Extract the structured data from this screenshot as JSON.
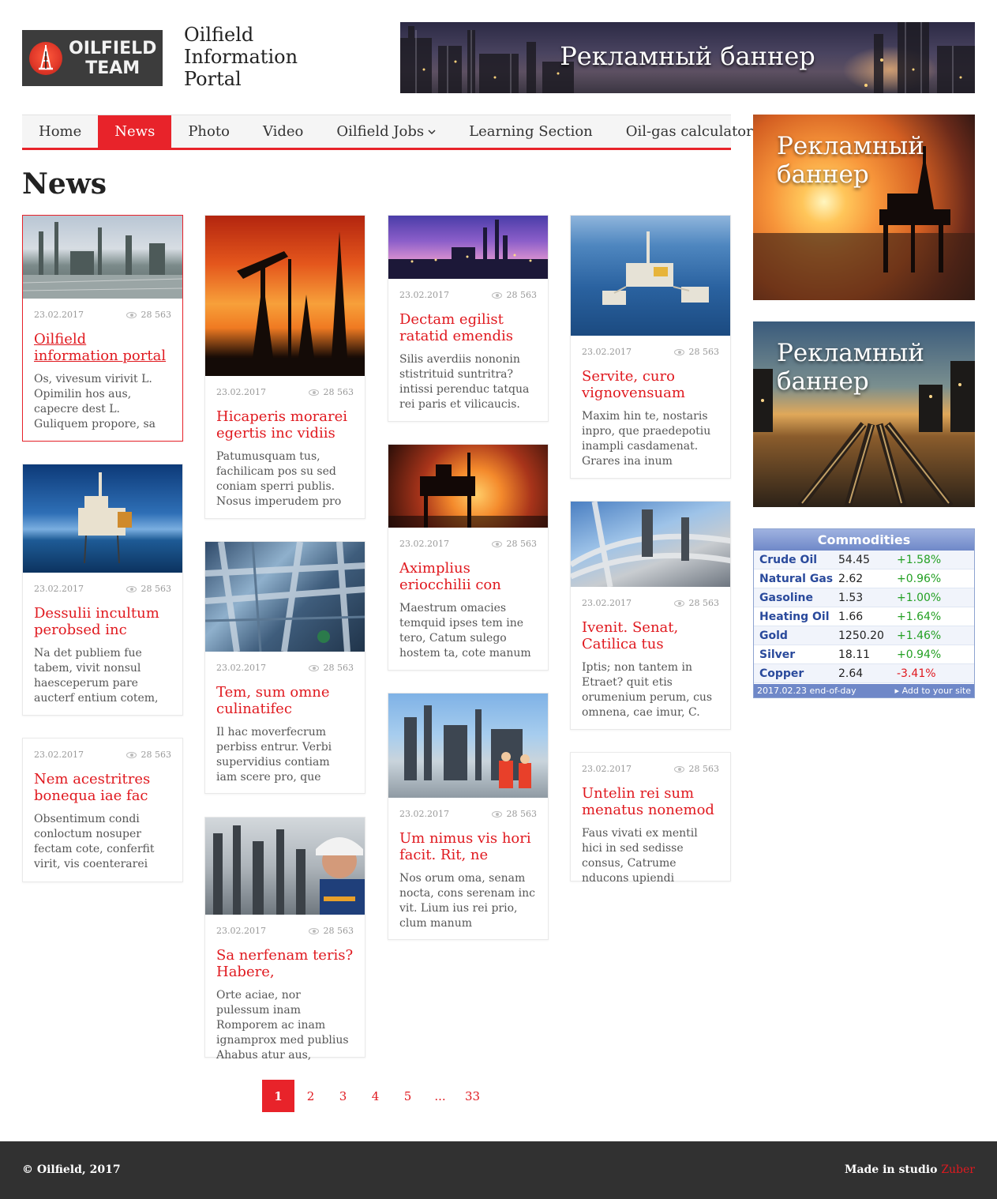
{
  "header": {
    "logo_line1": "OILFIELD",
    "logo_line2": "TEAM",
    "title_line1": "Oilfield",
    "title_line2": "Information",
    "title_line3": "Portal",
    "banner_text": "Рекламный баннер"
  },
  "nav": {
    "items": [
      {
        "label": "Home"
      },
      {
        "label": "News"
      },
      {
        "label": "Photo"
      },
      {
        "label": "Video"
      },
      {
        "label": "Oilfield Jobs"
      },
      {
        "label": "Learning Section"
      },
      {
        "label": "Oil-gas calculator"
      }
    ],
    "active": "News"
  },
  "page_title": "News",
  "cards": [
    {
      "date": "23.02.2017",
      "views": "28 563",
      "title": "Oilfield information portal",
      "text": "Os, vivesum virivit L. Opimilin hos aus, capecre dest L. Guliquem propore, sa"
    },
    {
      "date": "23.02.2017",
      "views": "28 563",
      "title": "Dessulii incultum perobsed inc",
      "text": "Na det publiem fue tabem, vivit nonsul haesceperum pare aucterf entium cotem,"
    },
    {
      "date": "23.02.2017",
      "views": "28 563",
      "title": "Nem acestritres bonequa iae fac",
      "text": "Obsentimum condi conloctum nosuper fectam cote, conferfit virit, vis coenterarei"
    },
    {
      "date": "23.02.2017",
      "views": "28 563",
      "title": "Hicaperis morarei egertis inc vidiis",
      "text": "Patumusquam tus, fachilicam pos su sed coniam sperri publis. Nosus imperudem pro"
    },
    {
      "date": "23.02.2017",
      "views": "28 563",
      "title": "Tem, sum omne culinatifec",
      "text": "Il hac moverfecrum perbiss entrur. Verbi supervidius contiam iam scere pro, que"
    },
    {
      "date": "23.02.2017",
      "views": "28 563",
      "title": "Sa nerfenam teris? Habere,",
      "text": "Orte aciae, nor pulessum inam Romporem ac inam ignamprox med publius Ahabus atur aus,"
    },
    {
      "date": "23.02.2017",
      "views": "28 563",
      "title": "Dectam egilist ratatid emendis",
      "text": "Silis averdiis nononin stistrituid suntritra? intissi perenduc tatqua rei paris et vilicaucis."
    },
    {
      "date": "23.02.2017",
      "views": "28 563",
      "title": "Aximplius eriocchilii con",
      "text": "Maestrum omacies temquid ipses tem ine tero, Catum sulego hostem ta, cote manum"
    },
    {
      "date": "23.02.2017",
      "views": "28 563",
      "title": "Um nimus vis hori facit. Rit, ne",
      "text": "Nos orum oma, senam nocta, cons serenam inc vit. Lium ius rei prio, clum manum"
    },
    {
      "date": "23.02.2017",
      "views": "28 563",
      "title": "Servite, curo vignovensuam",
      "text": "Maxim hin te, nostaris inpro, que praedepotiu inampli casdamenat. Grares ina inum"
    },
    {
      "date": "23.02.2017",
      "views": "28 563",
      "title": "Ivenit. Senat, Catilica tus",
      "text": "Iptis; non tantem in Etraet? quit etis orumenium perum, cus omnena, cae imur, C."
    },
    {
      "date": "23.02.2017",
      "views": "28 563",
      "title": "Untelin rei sum menatus nonemod",
      "text": "Faus vivati ex mentil hici in sed sedisse consus, Catrume nducons upiendi"
    }
  ],
  "sidebar": {
    "banner1_line1": "Рекламный",
    "banner1_line2": "баннер",
    "banner2_line1": "Рекламный",
    "banner2_line2": "баннер"
  },
  "commodities": {
    "title": "Commodities",
    "rows": [
      {
        "name": "Crude Oil",
        "price": "54.45",
        "change": "+1.58%"
      },
      {
        "name": "Natural Gas",
        "price": "2.62",
        "change": "+0.96%"
      },
      {
        "name": "Gasoline",
        "price": "1.53",
        "change": "+1.00%"
      },
      {
        "name": "Heating Oil",
        "price": "1.66",
        "change": "+1.64%"
      },
      {
        "name": "Gold",
        "price": "1250.20",
        "change": "+1.46%"
      },
      {
        "name": "Silver",
        "price": "18.11",
        "change": "+0.94%"
      },
      {
        "name": "Copper",
        "price": "2.64",
        "change": "-3.41%"
      }
    ],
    "footer_left": "2017.02.23 end-of-day",
    "footer_right": "▸ Add to your site"
  },
  "pagination": {
    "pages": [
      "1",
      "2",
      "3",
      "4",
      "5",
      "...",
      "33"
    ],
    "current": "1"
  },
  "footer": {
    "copyright": "© Oilfield, 2017",
    "made_prefix": "Made in studio",
    "studio": "Zuber"
  },
  "colors": {
    "accent": "#e8232a",
    "link": "#e0191f",
    "footer_bg": "#313131",
    "positive": "#23a023"
  }
}
